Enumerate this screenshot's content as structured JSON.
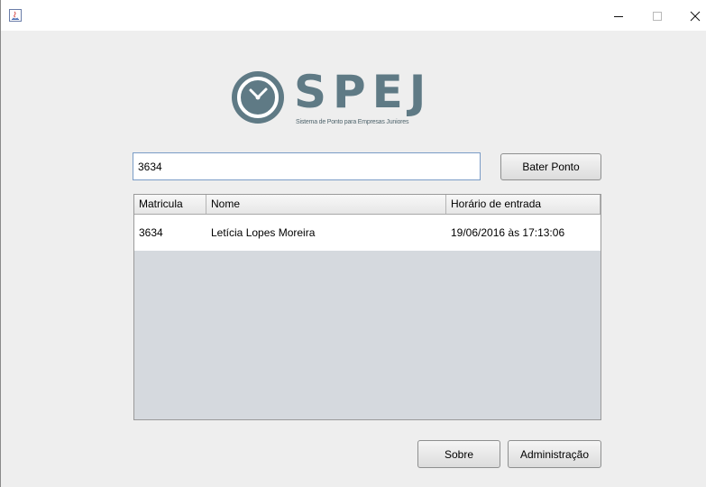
{
  "window": {
    "controls": {
      "minimize": "–",
      "maximize": "☐",
      "close": "✕"
    }
  },
  "logo": {
    "name": "SPEJ",
    "tagline": "Sistema de Ponto para Empresas Juniores",
    "color": "#5f7a85"
  },
  "form": {
    "badge_value": "3634",
    "clock_in_label": "Bater Ponto"
  },
  "table": {
    "columns": [
      "Matricula",
      "Nome",
      "Horário de entrada"
    ],
    "rows": [
      [
        "3634",
        "Letícia Lopes Moreira",
        "19/06/2016 às 17:13:06"
      ]
    ]
  },
  "footer": {
    "about_label": "Sobre",
    "admin_label": "Administração"
  }
}
